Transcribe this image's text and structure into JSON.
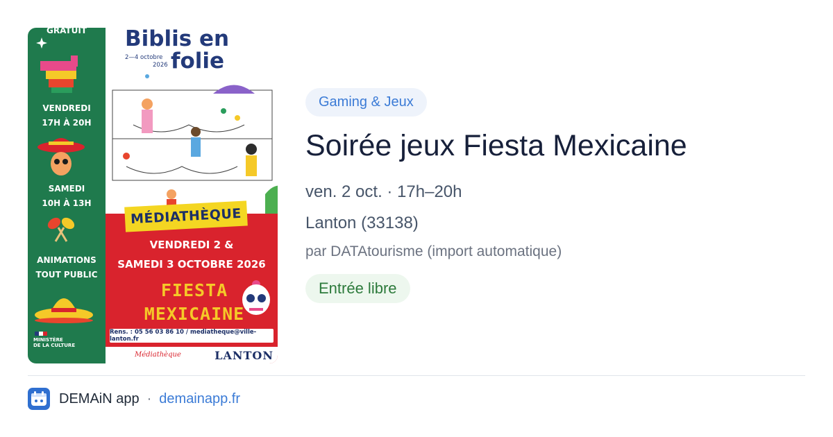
{
  "poster": {
    "gratuit": "GRATUIT",
    "title_line1": "Biblis en",
    "title_line2": "folie",
    "title_dates": "2—4 octobre",
    "title_year": "2026",
    "vendredi_label": "VENDREDI",
    "vendredi_hours": "17H À 20H",
    "samedi_label": "SAMEDI",
    "samedi_hours": "10H À 13H",
    "animations_line1": "ANIMATIONS",
    "animations_line2": "TOUT PUBLIC",
    "mediatheque": "MÉDIATHÈQUE",
    "dates_line1": "VENDREDI 2 &",
    "dates_line2": "SAMEDI 3 OCTOBRE 2026",
    "fiesta_line1": "FIESTA",
    "fiesta_line2": "MEXICAINE",
    "rens": "Rens. : 05 56 03 86 10 / mediatheque@ville-lanton.fr",
    "ministere_line1": "MINISTÈRE",
    "ministere_line2": "DE LA CULTURE",
    "bottom_logo": "Médiathèque",
    "lanton_logo": "LANTON"
  },
  "event": {
    "category": "Gaming & Jeux",
    "title": "Soirée jeux Fiesta Mexicaine",
    "date": "ven. 2 oct. · 17h–20h",
    "location": "Lanton (33138)",
    "source": "par DATAtourisme (import automatique)",
    "price": "Entrée libre"
  },
  "footer": {
    "app_name": "DEMAiN app",
    "separator": "·",
    "domain": "demainapp.fr"
  },
  "colors": {
    "category_text": "#3b7bd6",
    "category_bg": "#eef3fb",
    "price_text": "#2c7a3b",
    "price_bg": "#edf7ee",
    "poster_green": "#1f7a4d",
    "poster_red": "#d9232d",
    "poster_yellow": "#f4d622"
  }
}
